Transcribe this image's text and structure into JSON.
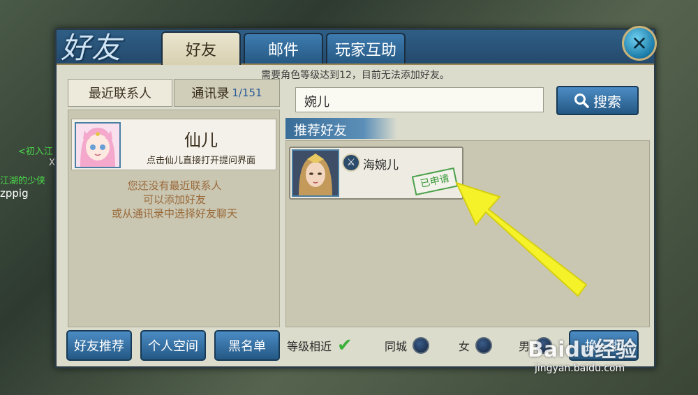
{
  "background": {
    "chat_lines": [
      "<初入江",
      "X",
      "江湖的少侠",
      "zppig"
    ]
  },
  "window": {
    "logo": "好友",
    "tabs": [
      {
        "label": "好友",
        "active": true
      },
      {
        "label": "邮件",
        "active": false
      },
      {
        "label": "玩家互助",
        "active": false
      }
    ],
    "close_icon": "close-icon",
    "notice": "需要角色等级达到12，目前无法添加好友。"
  },
  "left": {
    "tabs": [
      {
        "label": "最近联系人"
      },
      {
        "label": "通讯录",
        "count": "1/151"
      }
    ],
    "contact": {
      "name": "仙儿",
      "hint": "点击仙儿直接打开提问界面"
    },
    "empty_lines": [
      "您还没有最近联系人",
      "可以添加好友",
      "或从通讯录中选择好友聊天"
    ]
  },
  "search": {
    "value": "婉儿",
    "button_label": "搜索",
    "icon": "search-icon"
  },
  "recommend": {
    "header": "推荐好友",
    "friends": [
      {
        "name": "海婉儿",
        "status": "已申请"
      }
    ]
  },
  "bottom": {
    "buttons": [
      "好友推荐",
      "个人空间",
      "黑名单"
    ],
    "filters": [
      {
        "label": "等级相近",
        "checked": true
      },
      {
        "label": "同城",
        "checked": false
      },
      {
        "label": "女",
        "checked": false
      },
      {
        "label": "男",
        "checked": false
      }
    ],
    "more_button": "换一批"
  },
  "watermark": {
    "brand": "Baidu经验",
    "url": "jingyan.baidu.com"
  },
  "colors": {
    "accent_blue": "#245884",
    "panel_bg": "#dcdccd",
    "arrow_yellow": "#f6f22a",
    "stamp_green": "#3a9a3a"
  }
}
